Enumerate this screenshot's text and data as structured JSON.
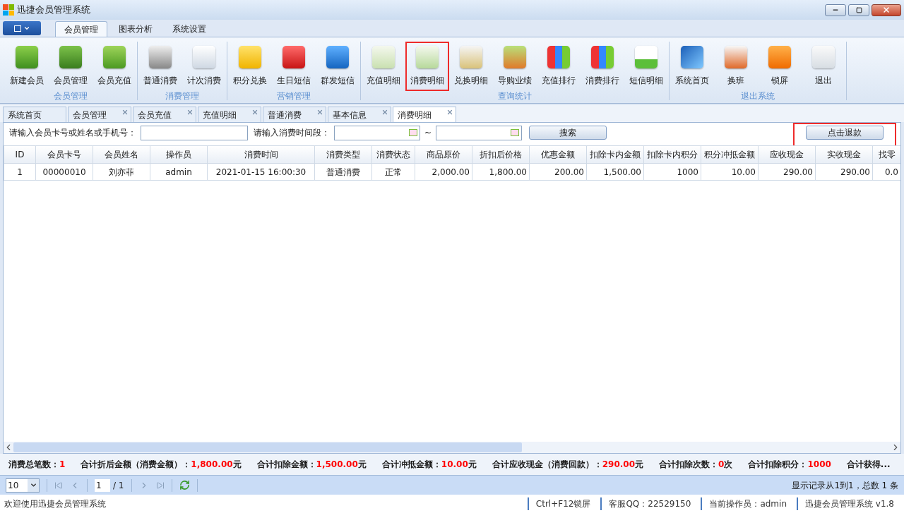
{
  "window": {
    "title": "迅捷会员管理系统"
  },
  "ribbon_tabs": [
    {
      "label": "会员管理",
      "selected": true
    },
    {
      "label": "图表分析",
      "selected": false
    },
    {
      "label": "系统设置",
      "selected": false
    }
  ],
  "ribbon_groups": [
    {
      "title": "会员管理",
      "items": [
        {
          "label": "新建会员",
          "highlighted": false
        },
        {
          "label": "会员管理",
          "highlighted": false
        },
        {
          "label": "会员充值",
          "highlighted": false
        }
      ]
    },
    {
      "title": "消费管理",
      "items": [
        {
          "label": "普通消费",
          "highlighted": false
        },
        {
          "label": "计次消费",
          "highlighted": false
        }
      ]
    },
    {
      "title": "营销管理",
      "items": [
        {
          "label": "积分兑换",
          "highlighted": false
        },
        {
          "label": "生日短信",
          "highlighted": false
        },
        {
          "label": "群发短信",
          "highlighted": false
        }
      ]
    },
    {
      "title": "查询统计",
      "items": [
        {
          "label": "充值明细",
          "highlighted": false
        },
        {
          "label": "消费明细",
          "highlighted": true
        },
        {
          "label": "兑换明细",
          "highlighted": false
        },
        {
          "label": "导购业绩",
          "highlighted": false
        },
        {
          "label": "充值排行",
          "highlighted": false
        },
        {
          "label": "消费排行",
          "highlighted": false
        },
        {
          "label": "短信明细",
          "highlighted": false
        }
      ]
    },
    {
      "title": "退出系统",
      "items": [
        {
          "label": "系统首页",
          "highlighted": false
        },
        {
          "label": "换班",
          "highlighted": false
        },
        {
          "label": "锁屏",
          "highlighted": false
        },
        {
          "label": "退出",
          "highlighted": false
        }
      ]
    }
  ],
  "doc_tabs": [
    {
      "label": "系统首页",
      "selected": false,
      "closable": false
    },
    {
      "label": "会员管理",
      "selected": false,
      "closable": true
    },
    {
      "label": "会员充值",
      "selected": false,
      "closable": true
    },
    {
      "label": "充值明细",
      "selected": false,
      "closable": true
    },
    {
      "label": "普通消费",
      "selected": false,
      "closable": true
    },
    {
      "label": "基本信息",
      "selected": false,
      "closable": true
    },
    {
      "label": "消费明细",
      "selected": true,
      "closable": true
    }
  ],
  "search": {
    "member_label": "请输入会员卡号或姓名或手机号：",
    "time_label": "请输入消费时间段：",
    "range_separator": "~",
    "search_button": "搜索",
    "refund_button": "点击退款",
    "refund_highlighted": true
  },
  "table": {
    "columns": [
      "ID",
      "会员卡号",
      "会员姓名",
      "操作员",
      "消费时间",
      "消费类型",
      "消费状态",
      "商品原价",
      "折扣后价格",
      "优惠金额",
      "扣除卡内金额",
      "扣除卡内积分",
      "积分冲抵金额",
      "应收现金",
      "实收现金",
      "找零"
    ],
    "rows": [
      [
        "1",
        "00000010",
        "刘亦菲",
        "admin",
        "2021-01-15 16:00:30",
        "普通消费",
        "正常",
        "2,000.00",
        "1,800.00",
        "200.00",
        "1,500.00",
        "1000",
        "10.00",
        "290.00",
        "290.00",
        "0.0"
      ]
    ]
  },
  "summary": [
    {
      "label": "消费总笔数：",
      "value": "1"
    },
    {
      "label": "合计折后金额（消费金额）：",
      "value": "1,800.00",
      "unit": "元"
    },
    {
      "label": "合计扣除金额：",
      "value": "1,500.00",
      "unit": "元"
    },
    {
      "label": "合计冲抵金额：",
      "value": "10.00",
      "unit": "元"
    },
    {
      "label": "合计应收现金（消费回款）：",
      "value": "290.00",
      "unit": "元"
    },
    {
      "label": "合计扣除次数：",
      "value": "0",
      "unit": "次"
    },
    {
      "label": "合计扣除积分：",
      "value": "1000"
    },
    {
      "label": "合计获得..."
    }
  ],
  "pager": {
    "page_size": "10",
    "page": "1",
    "total_pages": "/ 1",
    "info": "显示记录从1到1，总数 1 条"
  },
  "status_bar": {
    "welcome": "欢迎使用迅捷会员管理系统",
    "items": [
      "Ctrl+F12锁屏",
      "客服QQ：22529150",
      "当前操作员：admin",
      "迅捷会员管理系统 v1.8"
    ]
  }
}
